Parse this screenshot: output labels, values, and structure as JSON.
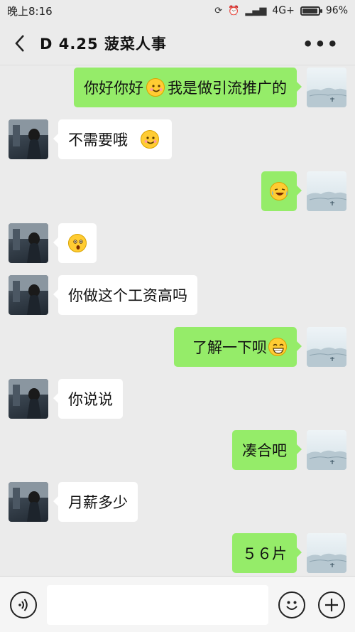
{
  "status_bar": {
    "time": "晚上8:16",
    "network": "4G+",
    "battery": "96%",
    "battery_level": 0.96
  },
  "header": {
    "title": "D  4.25  菠菜人事"
  },
  "messages": [
    {
      "side": "right",
      "text_a": "你好你好",
      "emoji": "smile-emoji",
      "text_b": "我是做引流推广的"
    },
    {
      "side": "left",
      "text": "不需要哦",
      "emoji": "smile-emoji"
    },
    {
      "side": "right",
      "emoji": "laugh-cry-emoji"
    },
    {
      "side": "left",
      "emoji": "surprised-emoji"
    },
    {
      "side": "left",
      "text": "你做这个工资高吗"
    },
    {
      "side": "right",
      "text": "了解一下呗",
      "emoji": "grin-emoji"
    },
    {
      "side": "left",
      "text": "你说说"
    },
    {
      "side": "right",
      "text": "凑合吧"
    },
    {
      "side": "left",
      "text": "月薪多少"
    },
    {
      "side": "right",
      "text": "５６片"
    }
  ],
  "input": {
    "placeholder": ""
  },
  "colors": {
    "background": "#ebebeb",
    "sent_bubble": "#95ec69",
    "received_bubble": "#ffffff"
  }
}
